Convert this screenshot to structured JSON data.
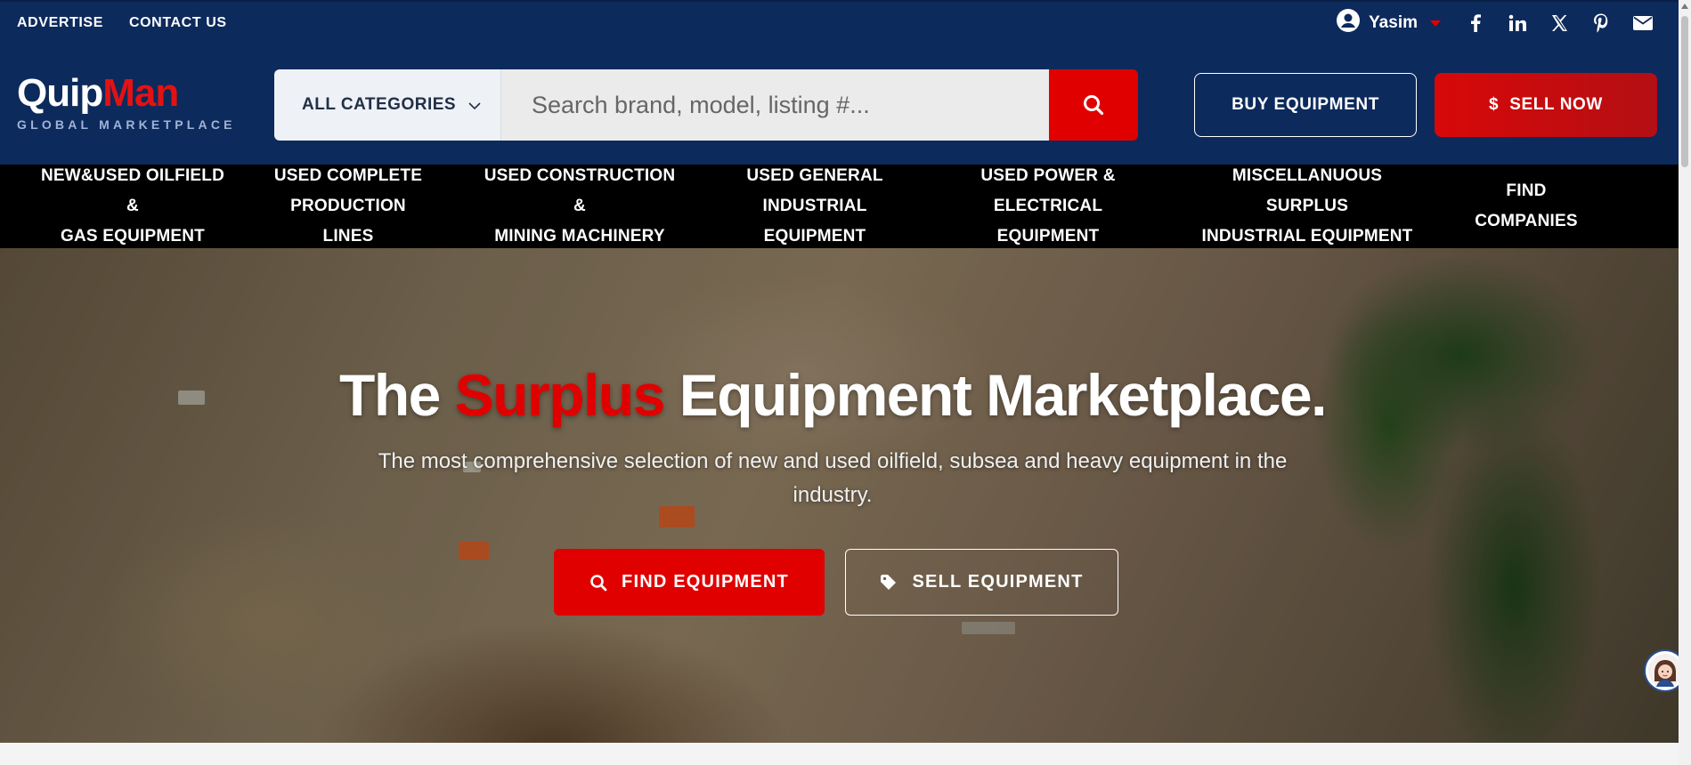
{
  "topbar": {
    "links": [
      "ADVERTISE",
      "CONTACT US"
    ],
    "user_name": "Yasim",
    "social_icons": [
      "facebook-icon",
      "linkedin-icon",
      "x-icon",
      "pinterest-icon",
      "mail-icon"
    ]
  },
  "header": {
    "logo_part1": "Quip",
    "logo_part2": "Man",
    "logo_tagline": "GLOBAL MARKETPLACE",
    "category_label": "ALL CATEGORIES",
    "search_placeholder": "Search brand, model, listing #...",
    "buy_label": "BUY EQUIPMENT",
    "sell_label": "SELL NOW",
    "sell_icon": "$"
  },
  "nav": {
    "items": [
      {
        "line1": "NEW&USED OILFIELD &",
        "line2": "GAS EQUIPMENT"
      },
      {
        "line1": "USED COMPLETE",
        "line2": "PRODUCTION LINES"
      },
      {
        "line1": "USED CONSTRUCTION &",
        "line2": "MINING MACHINERY"
      },
      {
        "line1": "USED GENERAL",
        "line2": "INDUSTRIAL EQUIPMENT"
      },
      {
        "line1": "USED POWER &",
        "line2": "ELECTRICAL EQUIPMENT"
      },
      {
        "line1": "MISCELLANUOUS SURPLUS",
        "line2": "INDUSTRIAL EQUIPMENT"
      },
      {
        "line1": "FIND COMPANIES",
        "line2": ""
      }
    ]
  },
  "hero": {
    "title_before": "The",
    "title_highlight": "Surplus",
    "title_after": "Equipment Marketplace.",
    "subtitle": "The most comprehensive selection of new and used oilfield, subsea and heavy equipment in the industry.",
    "find_label": "FIND EQUIPMENT",
    "sell_label": "SELL EQUIPMENT"
  },
  "colors": {
    "navy": "#0d2a5c",
    "accent_red": "#e00000",
    "nav_black": "#000000"
  }
}
